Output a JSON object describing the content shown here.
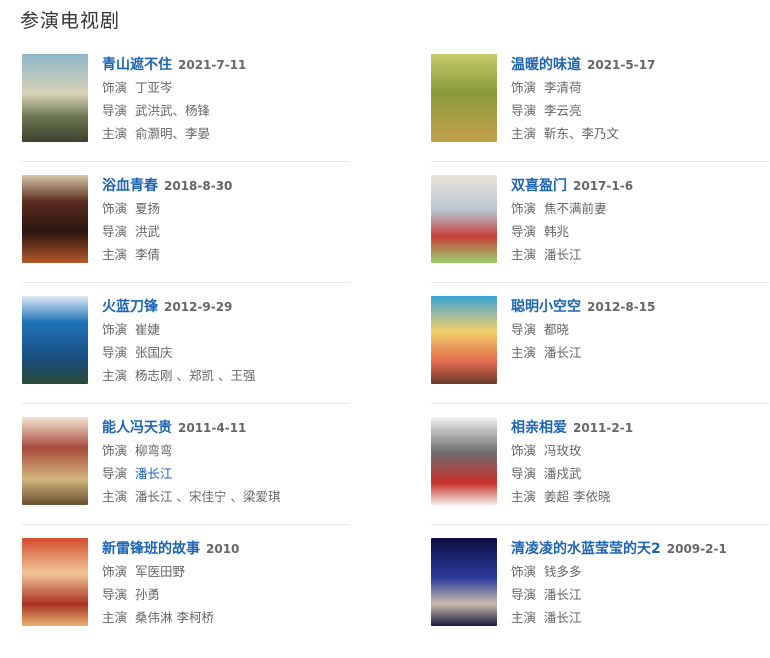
{
  "section": {
    "title": "参演电视剧"
  },
  "labels": {
    "role": "饰演",
    "director": "导演",
    "cast": "主演"
  },
  "dramas": [
    {
      "title": "青山遮不住",
      "date": "2021-7-11",
      "role": "丁亚岑",
      "director": "武洪武、杨锋",
      "cast": "俞灏明、李晏"
    },
    {
      "title": "温暖的味道",
      "date": "2021-5-17",
      "role": "李清荷",
      "director": "李云亮",
      "cast": "靳东、李乃文"
    },
    {
      "title": "浴血青春",
      "date": "2018-8-30",
      "role": "夏扬",
      "director": "洪武",
      "cast": "李倩"
    },
    {
      "title": "双喜盈门",
      "date": "2017-1-6",
      "role": "焦不满前妻",
      "director": "韩兆",
      "cast": "潘长江"
    },
    {
      "title": "火蓝刀锋",
      "date": "2012-9-29",
      "role": "崔婕",
      "director": "张国庆",
      "cast": "杨志刚 、郑凯 、王强"
    },
    {
      "title": "聪明小空空",
      "date": "2012-8-15",
      "director": "都晓",
      "cast": "潘长江"
    },
    {
      "title": "能人冯天贵",
      "date": "2011-4-11",
      "role": "柳弯弯",
      "director": "潘长江",
      "cast": "潘长江 、宋佳宁 、梁爱琪"
    },
    {
      "title": "相亲相爱",
      "date": "2011-2-1",
      "role": "冯玫玫",
      "director": "潘戍武",
      "cast": "姜超 李依晓"
    },
    {
      "title": "新雷锋班的故事",
      "date": "2010",
      "role": "军医田野",
      "director": "孙勇",
      "cast": "桑伟淋 李柯桥"
    },
    {
      "title": "清凌凌的水蓝莹莹的天2",
      "date": "2009-2-1",
      "role": "钱多多",
      "director": "潘长江",
      "cast": "潘长江"
    }
  ]
}
